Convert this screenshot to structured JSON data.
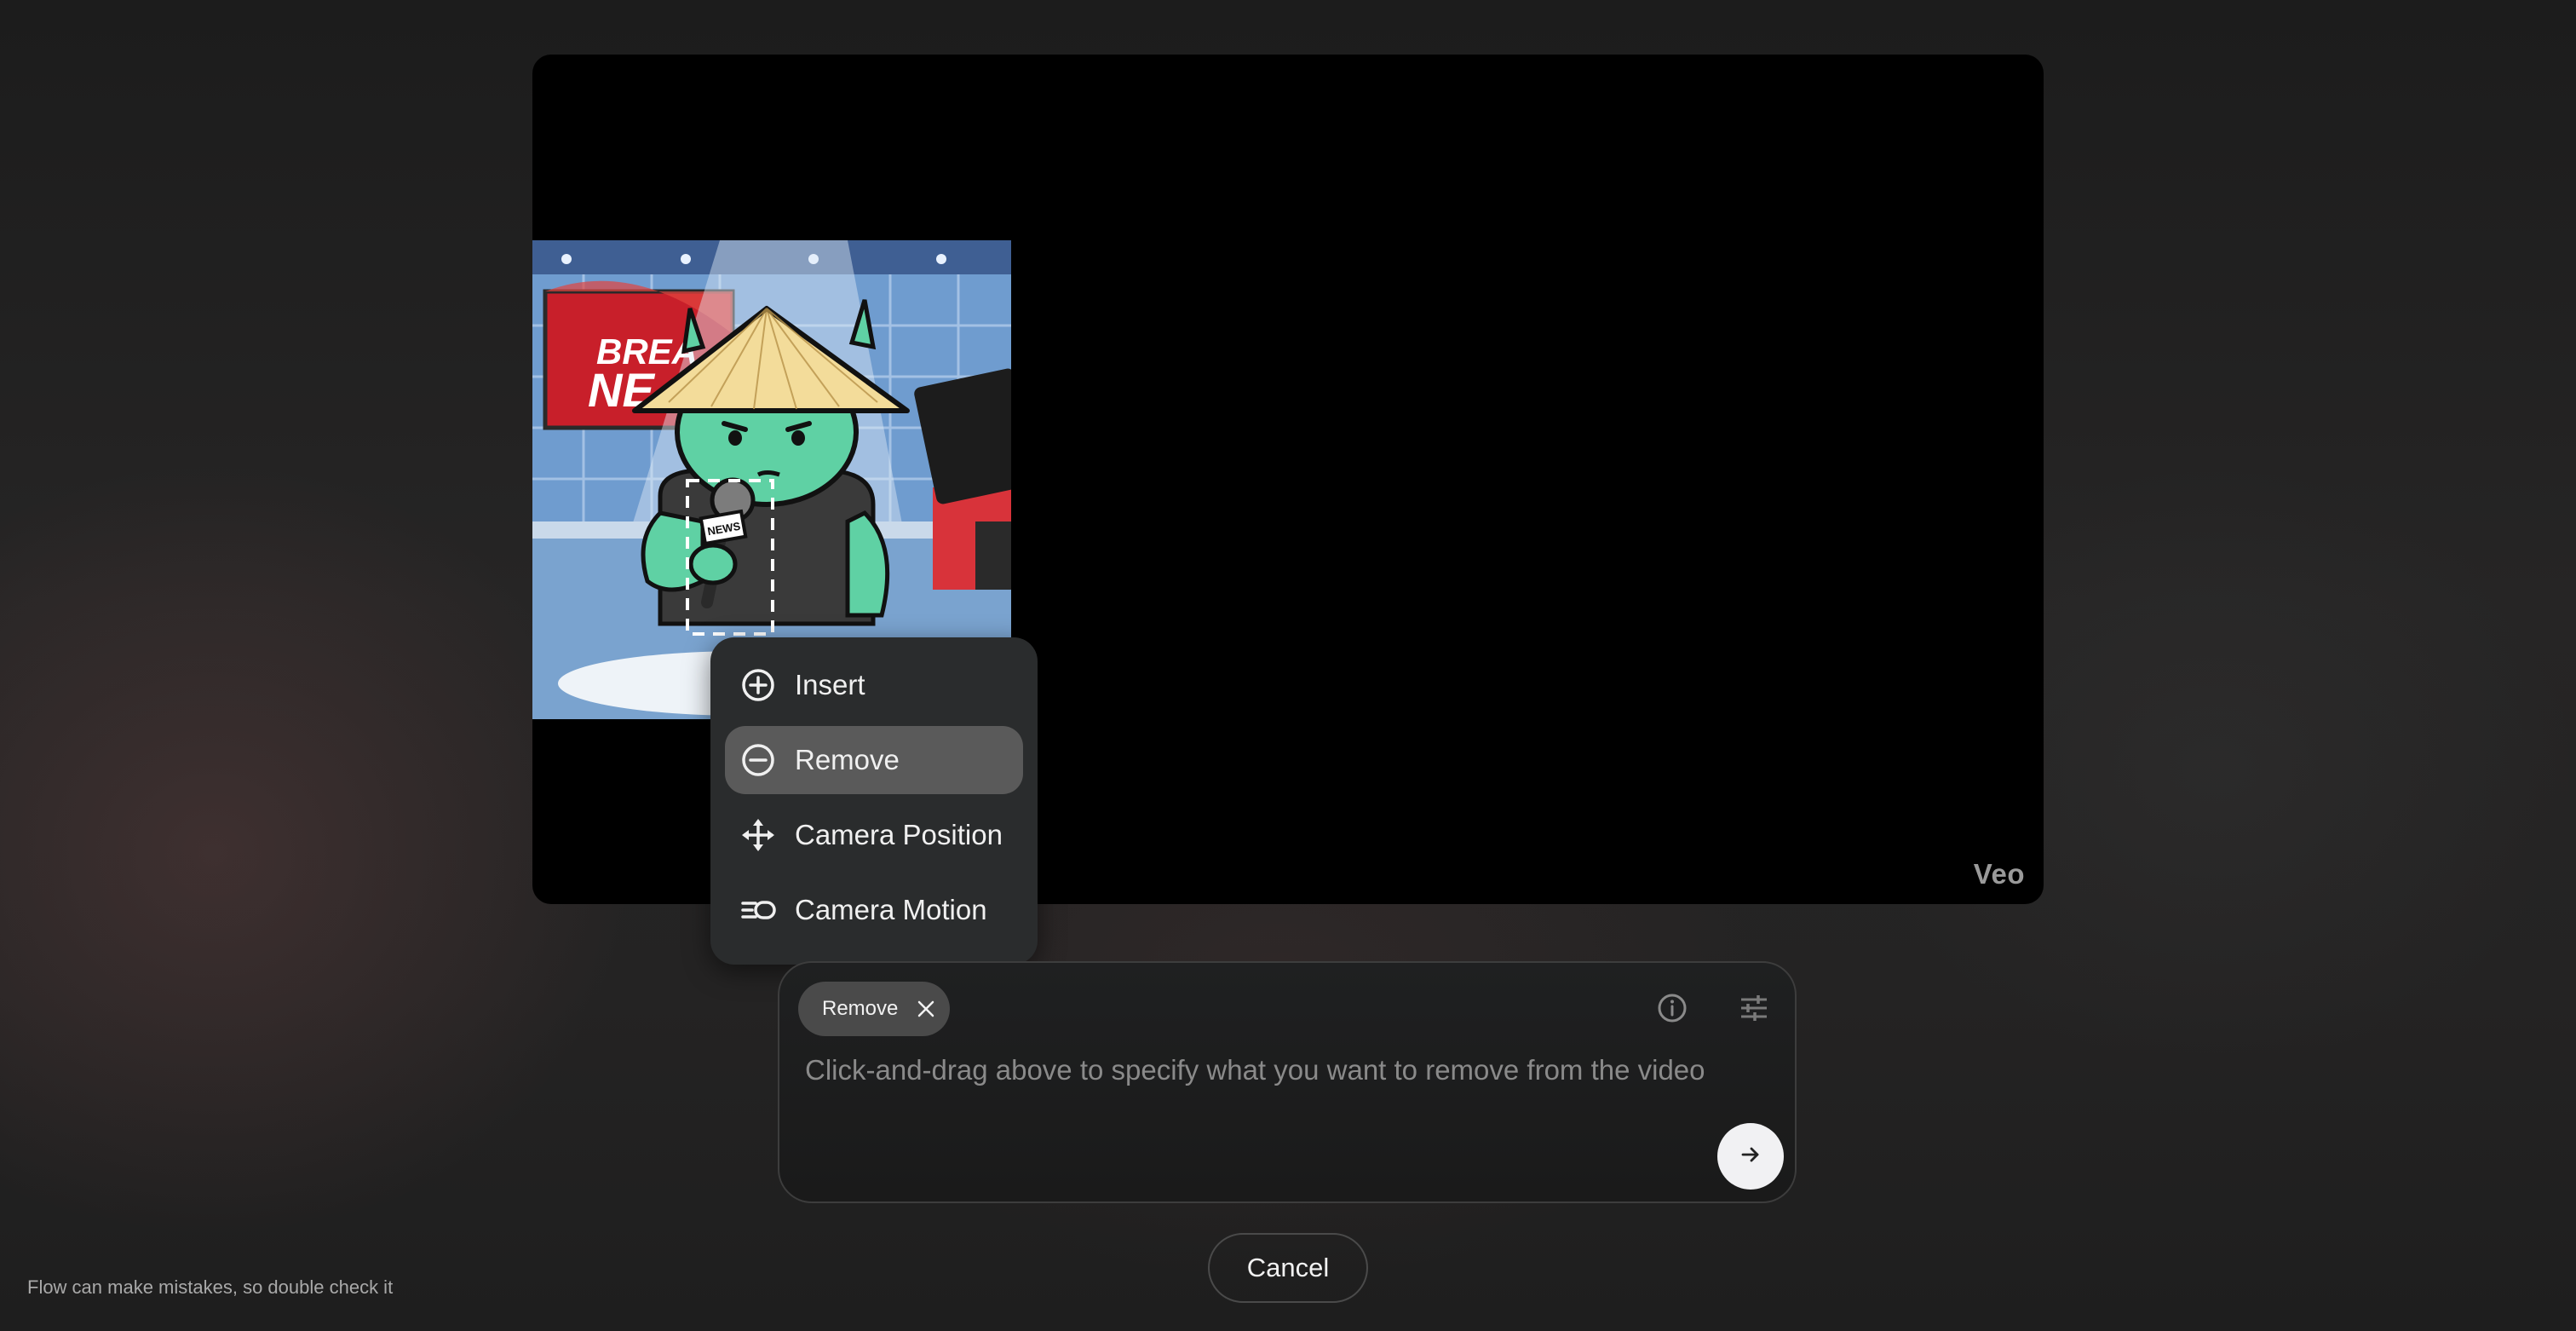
{
  "video": {
    "watermark": "Veo",
    "thumbnail": {
      "sign_text_line1": "BREA",
      "sign_text_line2": "NE",
      "mic_text": "NEWS"
    }
  },
  "menu": {
    "items": [
      {
        "label": "Insert",
        "icon": "plus-circle-icon",
        "active": false
      },
      {
        "label": "Remove",
        "icon": "minus-circle-icon",
        "active": true
      },
      {
        "label": "Camera Position",
        "icon": "move-arrows-icon",
        "active": false
      },
      {
        "label": "Camera Motion",
        "icon": "camera-motion-icon",
        "active": false
      }
    ]
  },
  "prompt": {
    "chip_label": "Remove",
    "placeholder": "Click-and-drag above to specify what you want to remove from the video",
    "value": ""
  },
  "actions": {
    "cancel_label": "Cancel"
  },
  "footer": {
    "disclaimer": "Flow can make mistakes, so double check it"
  },
  "colors": {
    "menu_bg": "#2a2c2d",
    "menu_active": "#5a5a5a",
    "send_button": "#f1f1f3",
    "background": "#242323"
  }
}
